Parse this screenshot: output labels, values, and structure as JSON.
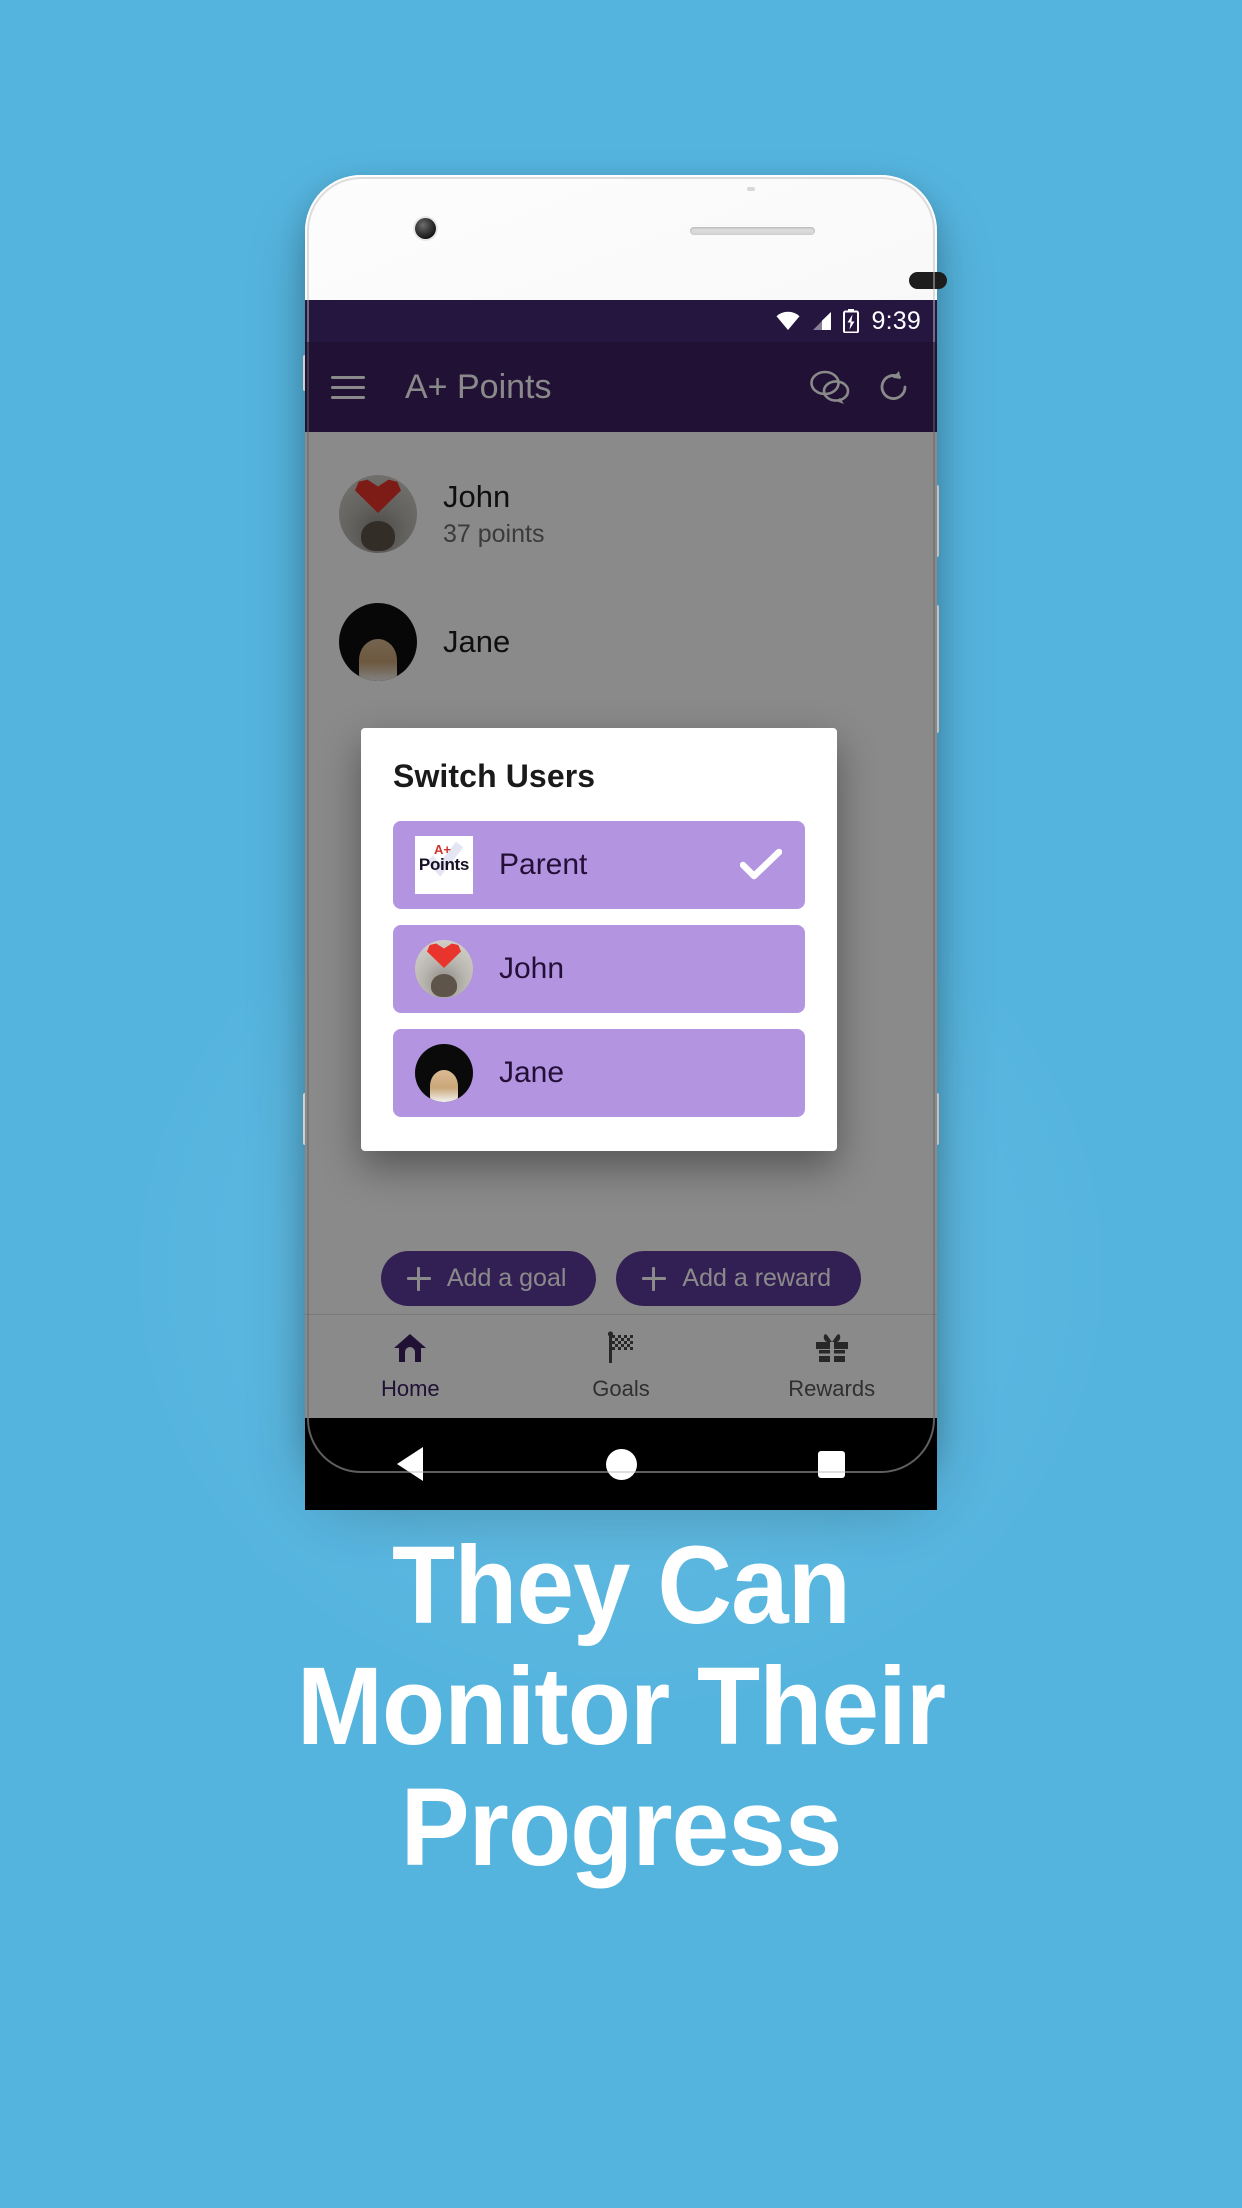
{
  "background_color": "#55b4de",
  "status_bar": {
    "time": "9:39",
    "icons": [
      "wifi-icon",
      "cellular-signal-icon",
      "battery-charging-icon"
    ]
  },
  "app_bar": {
    "menu_icon": "hamburger-menu-icon",
    "title": "A+ Points",
    "actions": [
      {
        "icon": "chat-bubbles-icon",
        "name": "messages-button"
      },
      {
        "icon": "refresh-icon",
        "name": "refresh-button"
      }
    ]
  },
  "user_list": [
    {
      "name": "John",
      "points": "37 points",
      "avatar": "john-avatar"
    },
    {
      "name": "Jane",
      "points": "",
      "avatar": "jane-avatar"
    }
  ],
  "action_buttons": [
    {
      "label": "Add a goal",
      "icon": "plus-icon"
    },
    {
      "label": "Add a reward",
      "icon": "plus-icon"
    }
  ],
  "bottom_nav": [
    {
      "label": "Home",
      "icon": "home-icon",
      "active": true
    },
    {
      "label": "Goals",
      "icon": "checkered-flag-icon",
      "active": false
    },
    {
      "label": "Rewards",
      "icon": "gift-icon",
      "active": false
    }
  ],
  "system_nav": [
    {
      "name": "back-button",
      "icon": "triangle-back-icon"
    },
    {
      "name": "home-button",
      "icon": "circle-home-icon"
    },
    {
      "name": "recents-button",
      "icon": "square-recents-icon"
    }
  ],
  "dialog": {
    "title": "Switch Users",
    "row_color": "#b394e0",
    "items": [
      {
        "label": "Parent",
        "avatar": "app-logo-tile",
        "selected": true,
        "check_icon": "check-icon"
      },
      {
        "label": "John",
        "avatar": "john-avatar",
        "selected": false,
        "check_icon": ""
      },
      {
        "label": "Jane",
        "avatar": "jane-avatar",
        "selected": false,
        "check_icon": ""
      }
    ],
    "logo_text": {
      "plus": "A+",
      "word": "Points"
    }
  },
  "headline": {
    "line1": "They Can",
    "line2": "Monitor Their",
    "line3": "Progress"
  }
}
